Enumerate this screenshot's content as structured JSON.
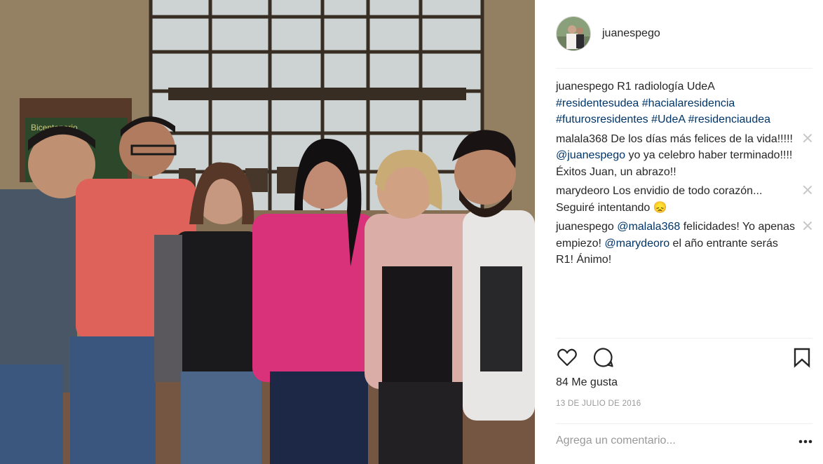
{
  "post": {
    "username": "juanespego",
    "caption": {
      "user": "juanespego",
      "text": "R1 radiología UdeA",
      "hashtags": [
        "#residentesudea",
        "#hacialaresidencia",
        "#futurosresidentes",
        "#UdeA",
        "#residenciaudea"
      ]
    },
    "comments": [
      {
        "user": "malala368",
        "text_1": "De los días más felices de la vida!!!!!",
        "mention_1": "@juanespego",
        "text_2": "yo ya celebro haber terminado!!!! Éxitos Juan, un abrazo!!"
      },
      {
        "user": "marydeoro",
        "text_1": "Los envidio de todo corazón... Seguiré intentando",
        "emoji": "😞"
      },
      {
        "user": "juanespego",
        "mention_1": "@malala368",
        "text_1": "felicidades! Yo apenas empiezo!",
        "mention_2": "@marydeoro",
        "text_2": "el año entrante serás R1! Ánimo!"
      }
    ],
    "likes": "84 Me gusta",
    "date": "13 DE JULIO DE 2016",
    "add_comment_placeholder": "Agrega un comentario...",
    "photo_sign": "Bicentenario"
  },
  "icons": [
    "heart-icon",
    "comment-icon",
    "bookmark-icon",
    "more-options-icon",
    "close-icon"
  ],
  "colors": {
    "link": "#003569",
    "text": "#262626",
    "muted": "#999999",
    "divider": "#efefef"
  }
}
